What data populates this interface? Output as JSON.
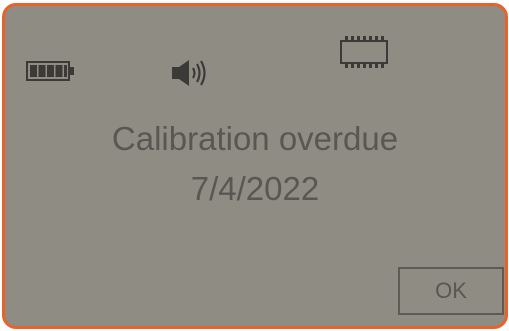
{
  "status_icons": {
    "battery": "battery-icon",
    "speaker": "speaker-icon",
    "memory": "memory-chip-icon"
  },
  "message": {
    "line1": "Calibration overdue",
    "line2": "7/4/2022"
  },
  "ok_button": {
    "label": "OK"
  },
  "colors": {
    "screen_background": "#8f8c84",
    "frame_accent": "#e8622a",
    "text": "#5a5753"
  }
}
